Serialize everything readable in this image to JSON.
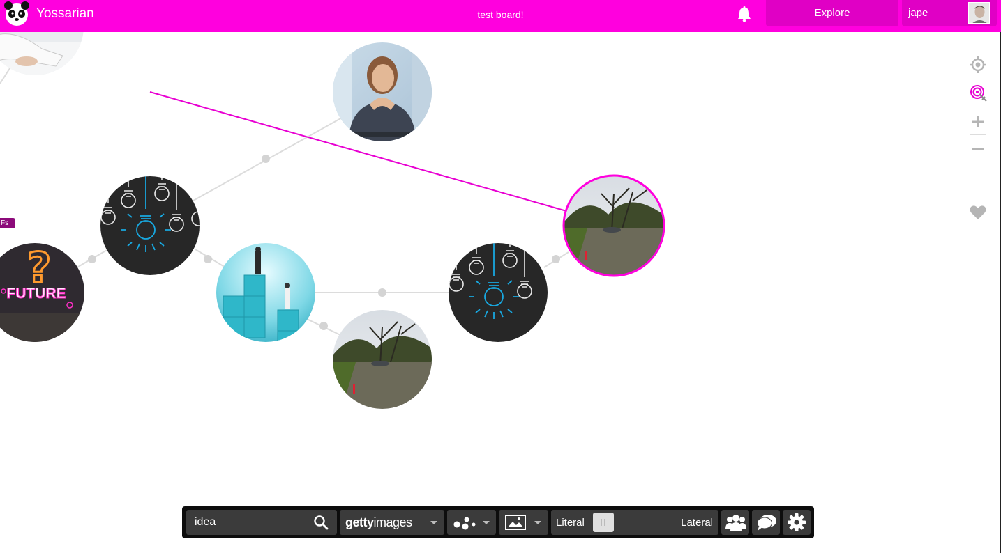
{
  "header": {
    "brand": "Yossarian",
    "board_title": "test board!",
    "explore_label": "Explore",
    "user_name": "jape"
  },
  "colors": {
    "brand_magenta": "#ff00de",
    "dark_magenta": "#e000c5",
    "link_line": "#e800d2",
    "connector": "#dcdcdc",
    "toolbar_bg": "#0d0d0d",
    "toolbar_segment": "#3b3b3b"
  },
  "board": {
    "node_tag": "Fs",
    "future_text": "FUTURE"
  },
  "toolbar": {
    "search_value": "idea",
    "source_bold": "getty",
    "source_light": "images",
    "slider_left_label": "Literal",
    "slider_right_label": "Lateral"
  },
  "icons": {
    "bell": "bell-icon",
    "search": "search-icon",
    "locate": "crosshair-icon",
    "target": "target-icon",
    "zoom_in": "plus-icon",
    "zoom_out": "minus-icon",
    "favorite": "heart-icon",
    "people": "group-icon",
    "chat": "chat-icon",
    "settings": "gear-icon"
  }
}
